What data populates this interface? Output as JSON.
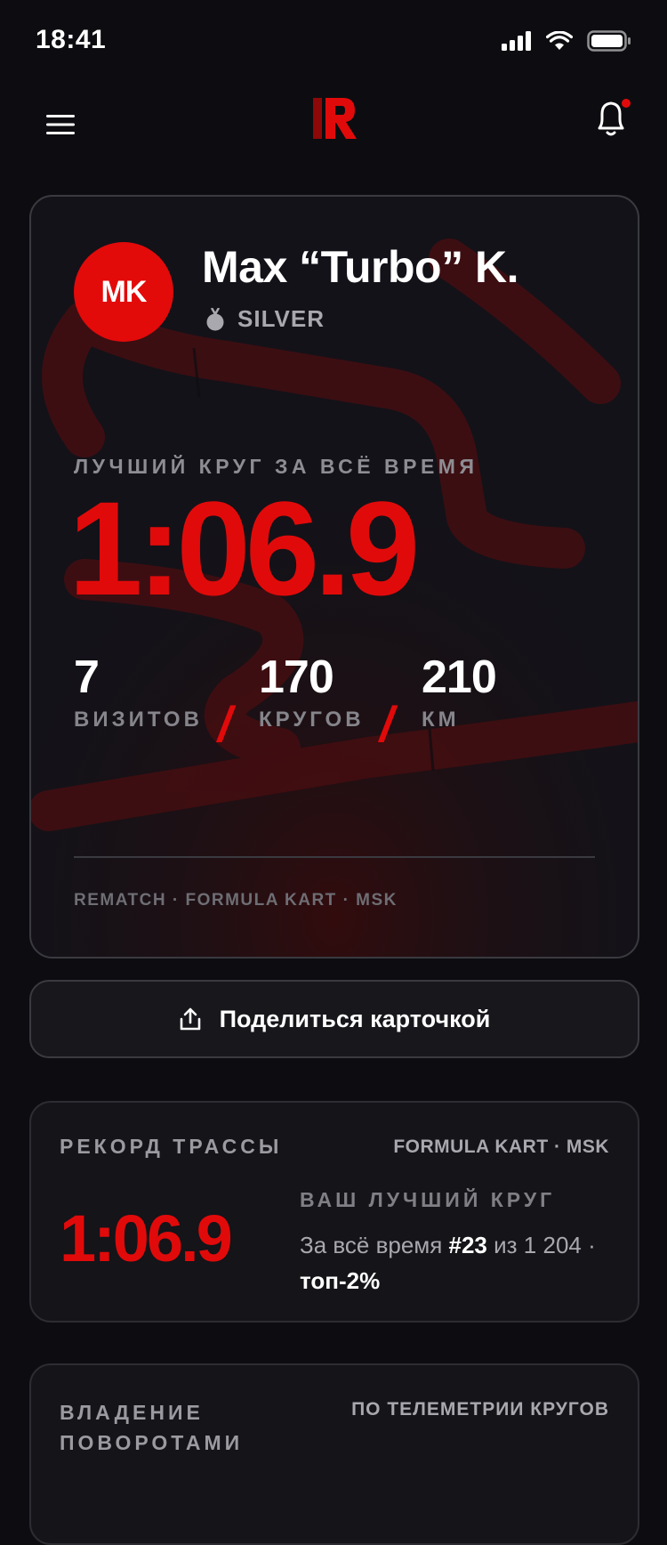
{
  "status_bar": {
    "time": "18:41"
  },
  "colors": {
    "accent": "#e10a0a",
    "background": "#0d0d11",
    "card": "#141419"
  },
  "header": {
    "menu_icon": "menu-icon",
    "logo_icon": "rematch-logo-icon",
    "notifications_icon": "bell-icon",
    "has_unread": true
  },
  "profile": {
    "initials": "MK",
    "name": "Max “Turbo” K.",
    "tier": "SILVER",
    "best_lap_label": "ЛУЧШИЙ КРУГ ЗА ВСЁ ВРЕМЯ",
    "best_lap": "1:06.9",
    "stats": [
      {
        "value": "7",
        "label": "ВИЗИТОВ"
      },
      {
        "value": "170",
        "label": "КРУГОВ"
      },
      {
        "value": "210",
        "label": "КМ"
      }
    ],
    "slash": "/",
    "footer": "REMATCH · FORMULA KART · MSK"
  },
  "share": {
    "label": "Поделиться карточкой"
  },
  "record": {
    "title": "РЕКОРД ТРАССЫ",
    "track": "FORMULA KART · MSK",
    "time": "1:06.9",
    "sub_label": "ВАШ ЛУЧШИЙ КРУГ",
    "text_pre": "За всё время ",
    "rank": "#23",
    "text_mid": " из 1 204 · ",
    "top": "топ-2%"
  },
  "corners": {
    "title": "ВЛАДЕНИЕ ПОВОРОТАМИ",
    "subtitle": "ПО ТЕЛЕМЕТРИИ КРУГОВ"
  }
}
